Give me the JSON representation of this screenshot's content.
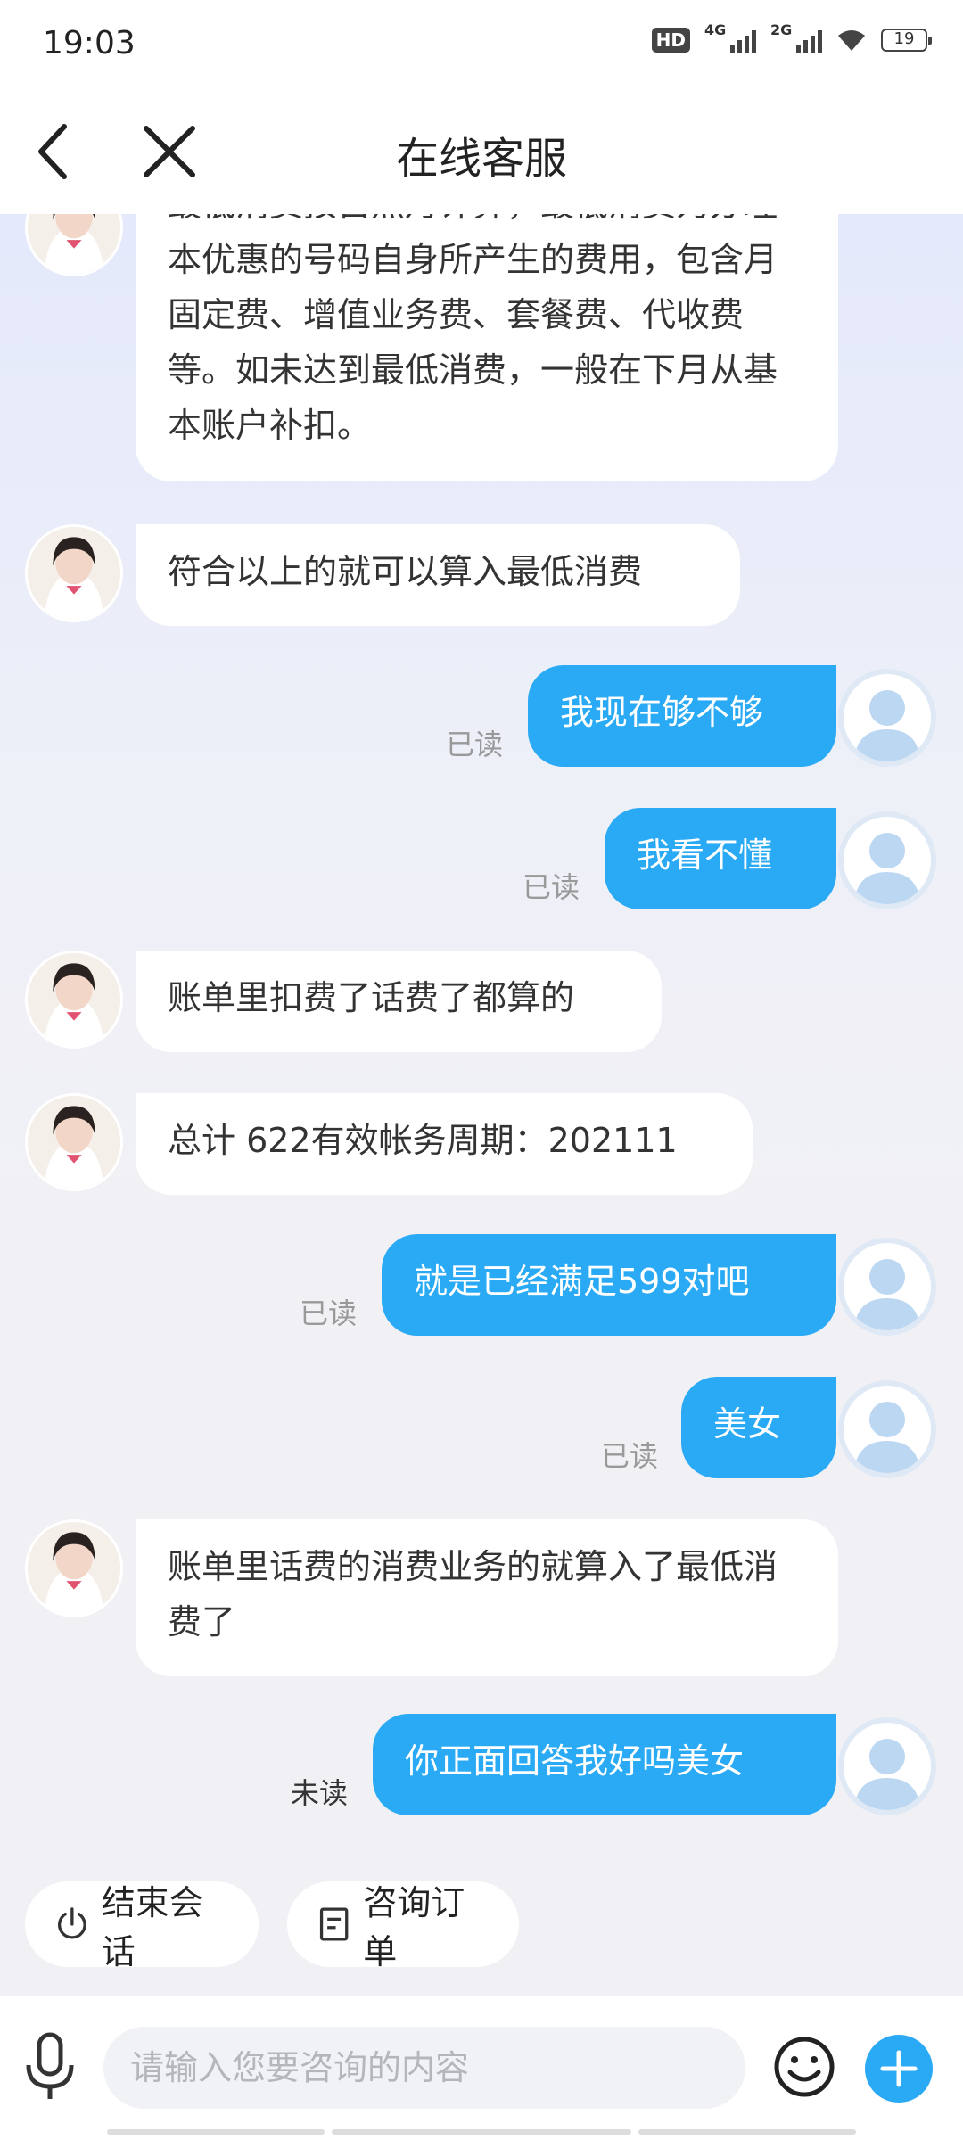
{
  "status_bar": {
    "time": "19:03",
    "hd_label": "HD",
    "sim1_label": "4G",
    "sim2_label": "2G",
    "battery_level": "19"
  },
  "header": {
    "title": "在线客服"
  },
  "messages": [
    {
      "from": "agent",
      "text": "最低消费按自然月计算，最低消费为办理本优惠的号码自身所产生的费用，包含月固定费、增值业务费、套餐费、代收费等。如未达到最低消费，一般在下月从基本账户补扣。"
    },
    {
      "from": "agent",
      "text": "符合以上的就可以算入最低消费"
    },
    {
      "from": "user",
      "text": "我现在够不够",
      "read_status": "已读"
    },
    {
      "from": "user",
      "text": "我看不懂",
      "read_status": "已读"
    },
    {
      "from": "agent",
      "text": "账单里扣费了话费了都算的"
    },
    {
      "from": "agent",
      "text": "总计 622有效帐务周期：202111"
    },
    {
      "from": "user",
      "text": "就是已经满足599对吧",
      "read_status": "已读"
    },
    {
      "from": "user",
      "text": "美女",
      "read_status": "已读"
    },
    {
      "from": "agent",
      "text": "账单里话费的消费业务的就算入了最低消费了"
    },
    {
      "from": "user",
      "text": "你正面回答我好吗美女",
      "read_status": "未读"
    }
  ],
  "quick_actions": [
    {
      "label": "结束会话",
      "icon": "power-icon"
    },
    {
      "label": "咨询订单",
      "icon": "document-icon"
    }
  ],
  "input": {
    "placeholder": "请输入您要咨询的内容",
    "value": ""
  },
  "colors": {
    "accent": "#2aaaf4",
    "background": "#f1f1f5"
  }
}
